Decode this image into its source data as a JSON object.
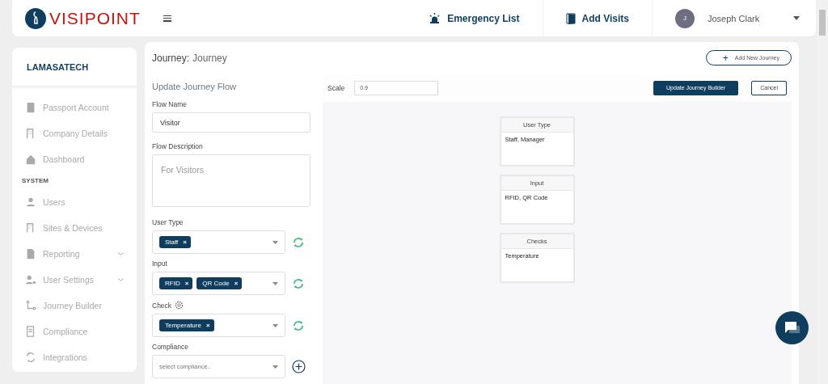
{
  "header": {
    "logo": "VISIPOINT",
    "actions": [
      {
        "label": "Emergency List",
        "kind": "alarm"
      },
      {
        "label": "Add Visits",
        "kind": "door"
      }
    ],
    "user": {
      "initial": "J",
      "name": "Joseph Clark"
    }
  },
  "sidebar": {
    "company": "LAMASATECH",
    "items": [
      {
        "kind": "item",
        "label": "Passport Account",
        "has_submenu": false
      },
      {
        "kind": "item",
        "label": "Company Details",
        "has_submenu": false
      },
      {
        "kind": "item",
        "label": "Dashboard",
        "has_submenu": false
      },
      {
        "kind": "section",
        "label": "SYSTEM"
      },
      {
        "kind": "item",
        "label": "Users",
        "has_submenu": false
      },
      {
        "kind": "item",
        "label": "Sites & Devices",
        "has_submenu": false
      },
      {
        "kind": "item",
        "label": "Reporting",
        "has_submenu": true
      },
      {
        "kind": "item",
        "label": "User Settings",
        "has_submenu": true
      },
      {
        "kind": "item",
        "label": "Journey Builder",
        "has_submenu": false
      },
      {
        "kind": "item",
        "label": "Compliance",
        "has_submenu": false
      },
      {
        "kind": "item",
        "label": "Integrations",
        "has_submenu": false
      }
    ]
  },
  "page": {
    "title_label": "Journey:",
    "title_value": "Journey",
    "add_button": "+",
    "add_label": "Add New Journey"
  },
  "form": {
    "heading": "Update Journey Flow",
    "flow_name": {
      "label": "Flow Name",
      "value": "Visitor"
    },
    "flow_description": {
      "label": "Flow Description",
      "placeholder": "For Visitors"
    },
    "selects": [
      {
        "label": "User Type",
        "has_settings": false,
        "kind": "refresh",
        "tags": [
          "Staff"
        ],
        "delete_mark": "×"
      },
      {
        "label": "Input",
        "has_settings": false,
        "kind": "refresh",
        "tags": [
          "RFID",
          "QR Code"
        ],
        "delete_mark": "×"
      },
      {
        "label": "Check",
        "has_settings": true,
        "kind": "refresh",
        "tags": [
          "Temperature"
        ],
        "delete_mark": "×"
      },
      {
        "label": "Compliance",
        "has_settings": false,
        "kind": "add",
        "placeholder": "select compliance.."
      }
    ]
  },
  "builder": {
    "scale_label": "Scale",
    "scale_value": "0.9",
    "update_button": "Update Journey Builder",
    "cancel_button": "Cancel",
    "nodes": [
      {
        "title": "User Type",
        "body": "Staff, Manager"
      },
      {
        "title": "Input",
        "body": "RFID, QR Code"
      },
      {
        "title": "Checks",
        "body": "Temperature"
      }
    ]
  }
}
